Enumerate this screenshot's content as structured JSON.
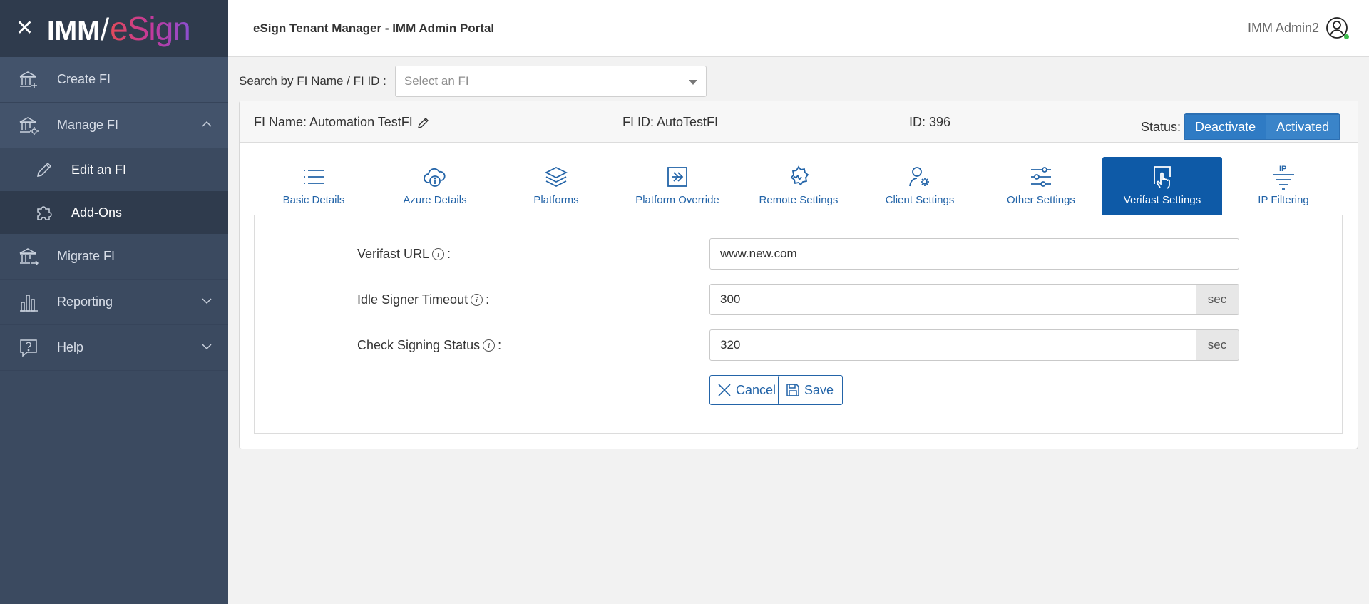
{
  "brand": {
    "imm": "IMM",
    "slash": "/",
    "esign": "eSign"
  },
  "sidebar": {
    "items": [
      {
        "label": "Create FI",
        "icon": "bank-plus-icon"
      },
      {
        "label": "Manage FI",
        "icon": "bank-gear-icon"
      },
      {
        "label": "Edit an FI",
        "icon": "pencil-icon"
      },
      {
        "label": "Add-Ons",
        "icon": "puzzle-icon"
      },
      {
        "label": "Migrate FI",
        "icon": "bank-arrow-icon"
      },
      {
        "label": "Reporting",
        "icon": "bar-chart-icon"
      },
      {
        "label": "Help",
        "icon": "help-bubble-icon"
      }
    ]
  },
  "header": {
    "title": "eSign Tenant Manager - IMM Admin Portal",
    "user": "IMM Admin2"
  },
  "search": {
    "label": "Search by FI Name / FI ID :",
    "placeholder": "Select an FI"
  },
  "fi": {
    "name": "FI Name: Automation TestFI",
    "fi_id": "FI ID: AutoTestFI",
    "id": "ID: 396",
    "status_label": "Status:",
    "deactivate": "Deactivate",
    "activated": "Activated"
  },
  "tabs": [
    {
      "label": "Basic Details",
      "icon": "list-icon"
    },
    {
      "label": "Azure Details",
      "icon": "cloud-info-icon"
    },
    {
      "label": "Platforms",
      "icon": "layers-icon"
    },
    {
      "label": "Platform Override",
      "icon": "arrow-box-icon"
    },
    {
      "label": "Remote Settings",
      "icon": "gear-signature-icon"
    },
    {
      "label": "Client Settings",
      "icon": "user-gear-icon"
    },
    {
      "label": "Other Settings",
      "icon": "sliders-icon"
    },
    {
      "label": "Verifast Settings",
      "icon": "hand-touch-icon"
    },
    {
      "label": "IP Filtering",
      "icon": "ip-filter-icon"
    }
  ],
  "active_tab": "Verifast Settings",
  "form": {
    "url_label": "Verifast URL",
    "url_value": "www.new.com",
    "idle_label": "Idle Signer Timeout",
    "idle_value": "300",
    "check_label": "Check Signing Status",
    "check_value": "320",
    "unit": "sec",
    "colon": ":",
    "cancel": "Cancel",
    "save": "Save"
  },
  "colors": {
    "sidebar_bg": "#3b4a60",
    "accent": "#0e5aa7",
    "link": "#2364a8"
  }
}
